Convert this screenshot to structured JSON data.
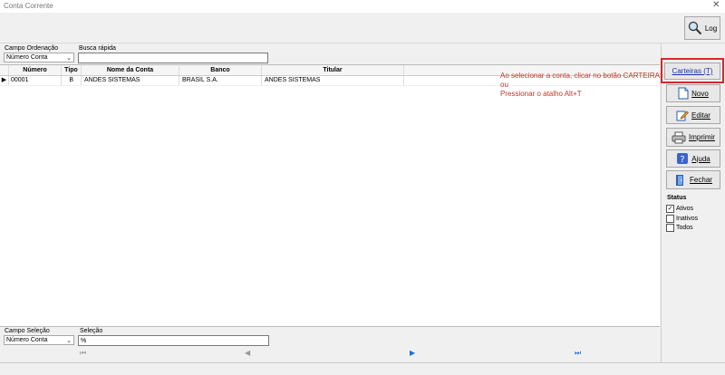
{
  "window": {
    "title": "Conta Corrente",
    "close_glyph": "✕"
  },
  "toolbar": {
    "log_label": "Log",
    "log_icon": "search-icon"
  },
  "filters": {
    "ordering_label": "Campo Ordenação",
    "ordering_value": "Número Conta",
    "quick_search_label": "Busca rápida",
    "quick_search_value": ""
  },
  "table": {
    "columns": [
      "Número",
      "Tipo",
      "Nome da Conta",
      "Banco",
      "Titular"
    ],
    "rows": [
      {
        "indicator": "▶",
        "numero": "00001",
        "tipo": "B",
        "nome": "ANDES SISTEMAS",
        "banco": "BRASIL S.A.",
        "titular": "ANDES SISTEMAS"
      }
    ]
  },
  "note": {
    "line1": "Ao selecionar a conta, clicar no botão CARTEIRAS",
    "line2": "ou",
    "line3": "Pressionar o atalho Alt+T",
    "color": "#c0392b"
  },
  "sidebar": {
    "carteiras_label": "Carteiras (T)",
    "novo_label": "Novo",
    "editar_label": "Editar",
    "imprimir_label": "Imprimir",
    "ajuda_label": "Ajuda",
    "fechar_label": "Fechar",
    "status_title": "Status",
    "status_options": [
      {
        "label": "Ativos",
        "checked": true
      },
      {
        "label": "Inativos",
        "checked": false
      },
      {
        "label": "Todos",
        "checked": false
      }
    ]
  },
  "bottom": {
    "campo_selecao_label": "Campo Seleção",
    "campo_selecao_value": "Número Conta",
    "selecao_label": "Seleção",
    "selecao_value": "%"
  },
  "nav": {
    "first": "⏮",
    "prev": "◀",
    "next": "▶",
    "last": "⏭"
  },
  "colors": {
    "highlight_box": "#d42a2a",
    "nav_active": "#1e6fd9"
  }
}
